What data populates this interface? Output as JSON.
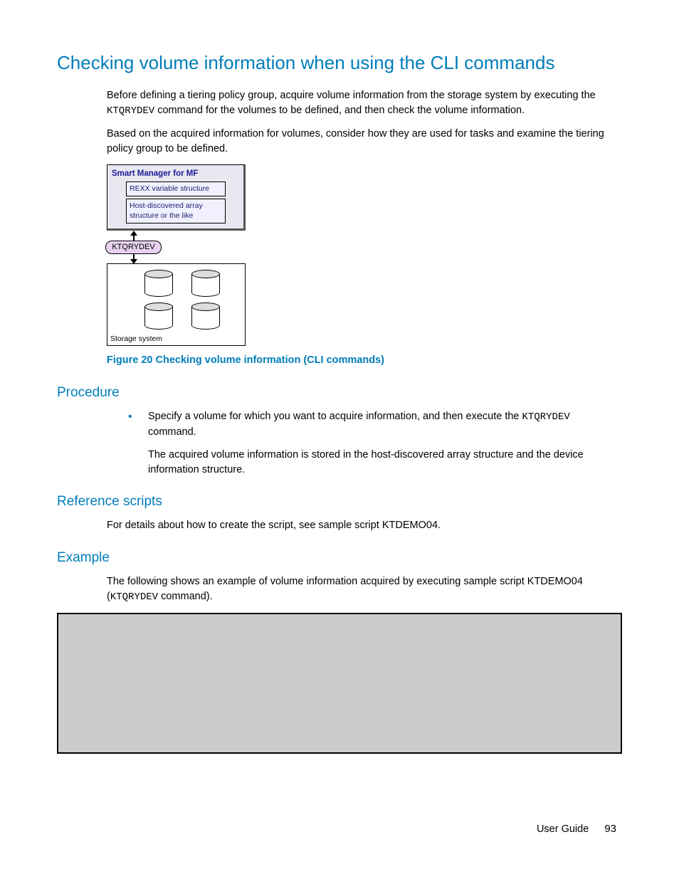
{
  "title": "Checking volume information when using the CLI commands",
  "intro_p1a": "Before defining a tiering policy group, acquire volume information from the storage system by executing the ",
  "intro_cmd1": "KTQRYDEV",
  "intro_p1b": " command for the volumes to be defined, and then check the volume information.",
  "intro_p2": "Based on the acquired information for volumes, consider how they are used for tasks and examine the tiering policy group to be defined.",
  "diagram": {
    "smart_title": "Smart Manager for MF",
    "inner1": "REXX variable structure",
    "inner2": "Host-discovered array structure or the like",
    "command": "KTQRYDEV",
    "storage_label": "Storage system"
  },
  "figure_caption": "Figure 20 Checking volume information (CLI commands)",
  "procedure": {
    "heading": "Procedure",
    "bullet_a": "Specify a volume for which you want to acquire information, and then execute the ",
    "bullet_cmd": "KTQRYDEV",
    "bullet_b": " command.",
    "sub": "The acquired volume information is stored in the host-discovered array structure and the device information structure."
  },
  "reference": {
    "heading": "Reference scripts",
    "body": "For details about how to create the script, see sample script KTDEMO04."
  },
  "example": {
    "heading": "Example",
    "body_a": "The following shows an example of volume information acquired by executing sample script KTDEMO04 (",
    "body_cmd": "KTQRYDEV",
    "body_b": " command)."
  },
  "footer": {
    "label": "User Guide",
    "page": "93"
  }
}
